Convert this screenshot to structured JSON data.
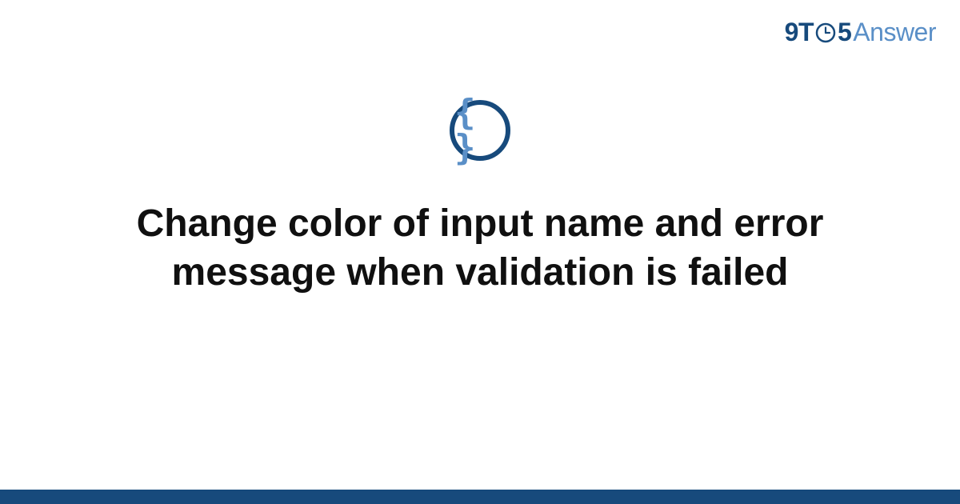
{
  "logo": {
    "nine": "9",
    "t": "T",
    "five": "5",
    "answer": "Answer"
  },
  "icon": {
    "braces": "{ }"
  },
  "title": "Change color of input name and error message when validation is failed",
  "colors": {
    "primary": "#174a7c",
    "accent": "#5a8fc7",
    "text": "#101010"
  }
}
